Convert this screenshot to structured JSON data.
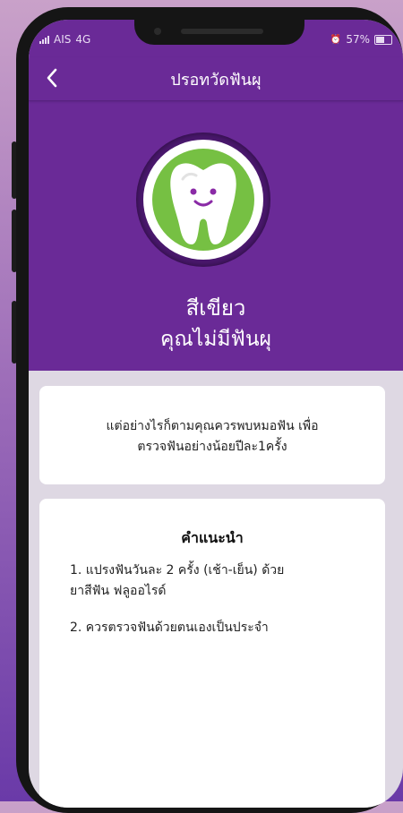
{
  "status_bar": {
    "carrier": "AIS",
    "network": "4G",
    "battery": "57%"
  },
  "header": {
    "title": "ปรอทวัดฟันผุ"
  },
  "result": {
    "color_label": "สีเขียว",
    "message": "คุณไม่มีฟันผุ",
    "indicator_color": "#76c043"
  },
  "info_card": {
    "line1": "แต่อย่างไรก็ตามคุณควรพบหมอฟัน เพื่อ",
    "line2": "ตรวจฟันอย่างน้อยปีละ1ครั้ง"
  },
  "advice_card": {
    "title": "คำแนะนำ",
    "items": [
      {
        "line1": "1. แปรงฟันวันละ 2 ครั้ง (เช้า-เย็น) ด้วย",
        "line2": "ยาสีฟัน ฟลูออไรด์"
      },
      {
        "line1": "2. ควรตรวจฟันด้วยตนเองเป็นประจำ"
      }
    ]
  },
  "colors": {
    "brand_purple": "#6a2a97",
    "screen_background": "#ded8e3",
    "card_background": "#ffffff"
  },
  "icons": {
    "back": "chevron-left-icon",
    "tooth": "smiling-tooth-icon"
  }
}
